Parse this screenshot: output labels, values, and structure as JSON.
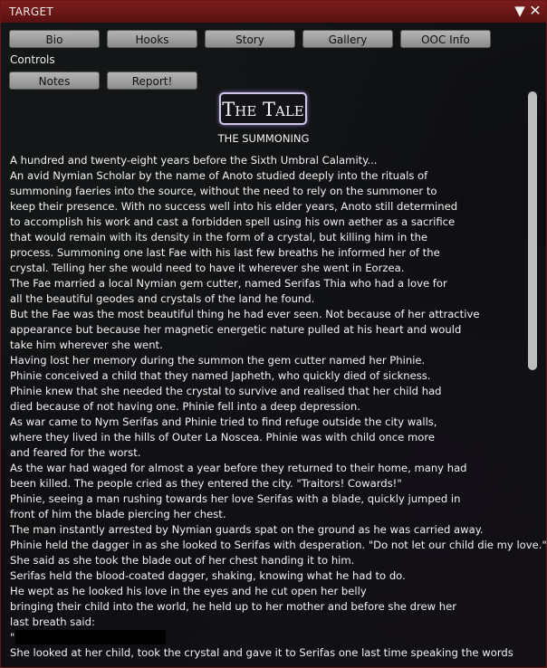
{
  "window": {
    "title": "TARGET",
    "collapse_icon": "▼",
    "close_icon": "✕"
  },
  "nav": {
    "bio": "Bio",
    "hooks": "Hooks",
    "story": "Story",
    "gallery": "Gallery",
    "ooc_info": "OOC Info"
  },
  "controls": {
    "label": "Controls",
    "notes": "Notes",
    "report": "Report!"
  },
  "story_page": {
    "heading": "The Tale",
    "subtitle": "THE SUMMONING",
    "lines": [
      "A hundred and twenty-eight years before the Sixth Umbral Calamity...",
      "An avid Nymian Scholar by the name of Anoto studied deeply into the rituals of",
      "summoning faeries into the source, without the need to rely on the summoner to",
      "keep their presence. With no success well into his elder years, Anoto still determined",
      "to accomplish his work and cast a forbidden spell using his own aether as a sacrifice",
      "that would remain with its density in the form of a crystal, but killing him in the",
      "process. Summoning one last Fae with his last few breaths he informed her of the",
      "crystal. Telling her she would need to have it wherever she went in Eorzea.",
      "The Fae married a local Nymian gem cutter, named Serifas Thia who had a love for",
      "all the beautiful geodes and crystals of the land he found.",
      "But the Fae was the most beautiful thing he had ever seen. Not because of her attractive",
      "appearance but because her magnetic energetic nature pulled at his heart and would",
      "take him wherever she went.",
      "Having lost her memory during the summon the gem cutter named her Phinie.",
      "Phinie conceived a child that they named Japheth, who quickly died of sickness.",
      "Phinie knew that she needed the crystal to survive and realised that her child had",
      "died because of not having one. Phinie fell into a deep depression.",
      "As war came to Nym Serifas and Phinie tried to find refuge outside the city walls,",
      "where they lived in the hills of Outer La Noscea. Phinie was with child once more",
      "and feared for the worst.",
      "As the war had waged for almost a year before they returned to their home, many had",
      "been killed. The people cried as they entered the city. \"Traitors! Cowards!\"",
      "Phinie, seeing a man rushing towards her love Serifas with a blade, quickly jumped in",
      "front of him the blade piercing her chest.",
      "The man instantly arrested by Nymian guards spat on the ground as he was carried away.",
      "Phinie held the dagger in as she looked to Serifas with desperation. \"Do not let our child die my love.\"",
      "She said as she took the blade out of her chest handing it to him.",
      "Serifas held the blood-coated dagger, shaking, knowing what he had to do.",
      "He wept as he looked his love in the eyes and he cut open her belly",
      "bringing their child into the world, he held up to her mother and before she drew her",
      "last breath said:",
      "\"",
      "She looked at her child, took the crystal and gave it to Serifas one last time speaking the words"
    ]
  }
}
